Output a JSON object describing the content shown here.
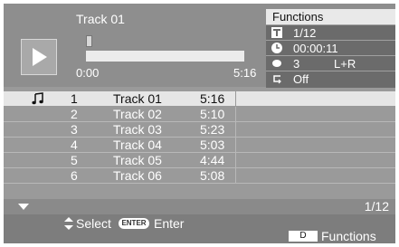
{
  "now_playing": {
    "title": "Track 01",
    "time_start": "0:00",
    "time_end": "5:16",
    "progress_fraction": 0.0
  },
  "functions": {
    "header": "Functions",
    "title_value": "1/12",
    "time_value": "00:00:11",
    "audio_value": "3",
    "audio_channel": "L+R",
    "repeat_value": "Off",
    "icons": [
      "title-icon",
      "clock-icon",
      "audio-icon",
      "repeat-icon"
    ]
  },
  "tracks": [
    {
      "num": "1",
      "name": "Track 01",
      "time": "5:16"
    },
    {
      "num": "2",
      "name": "Track 02",
      "time": "5:10"
    },
    {
      "num": "3",
      "name": "Track 03",
      "time": "5:23"
    },
    {
      "num": "4",
      "name": "Track 04",
      "time": "5:03"
    },
    {
      "num": "5",
      "name": "Track 05",
      "time": "4:44"
    },
    {
      "num": "6",
      "name": "Track 06",
      "time": "5:08"
    }
  ],
  "page": "1/12",
  "footer": {
    "select_label": "Select",
    "enter_badge": "ENTER",
    "enter_label": "Enter",
    "d_badge": "D",
    "functions_label": "Functions"
  },
  "colors": {
    "background": "#9a9a9a",
    "selected_row": "#e6e6e6",
    "panel": "#6b6b6b"
  }
}
